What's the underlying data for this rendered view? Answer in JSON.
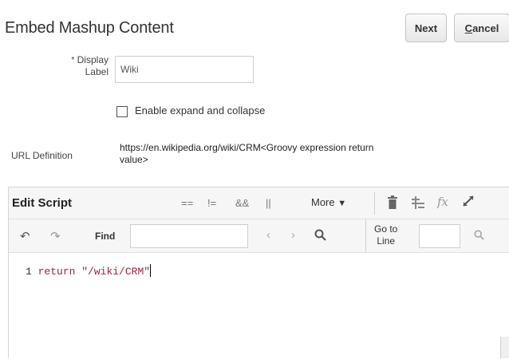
{
  "page": {
    "title": "Embed Mashup Content",
    "next_label": "Next",
    "cancel_first": "C",
    "cancel_rest": "ancel"
  },
  "form": {
    "required_mark": "*",
    "display_label_line1": "Display",
    "display_label_line2": "Label",
    "display_label_value": "Wiki",
    "expand_collapse_label": "Enable expand and collapse",
    "expand_collapse_checked": false,
    "url_label": "URL Definition",
    "url_value_line1": "https://en.wikipedia.org/wiki/CRM<Groovy expression return",
    "url_value_line2": "value>"
  },
  "editor": {
    "title": "Edit Script",
    "operators": [
      "==",
      "!=",
      "&&",
      "||"
    ],
    "more_label": "More",
    "find_label": "Find",
    "find_value": "",
    "goto_line1": "Go to",
    "goto_line2": "Line",
    "goto_value": "",
    "line_number": "1",
    "code_keyword": "return",
    "code_string": "\"/wiki/CRM\""
  },
  "icons": {
    "undo": "undo-icon",
    "redo": "redo-icon",
    "prev": "chevron-left-icon",
    "next": "chevron-right-icon",
    "search": "search-icon",
    "delete": "trash-icon",
    "format": "format-icon",
    "function": "function-icon",
    "expand": "expand-icon",
    "dropdown": "caret-down-icon"
  }
}
